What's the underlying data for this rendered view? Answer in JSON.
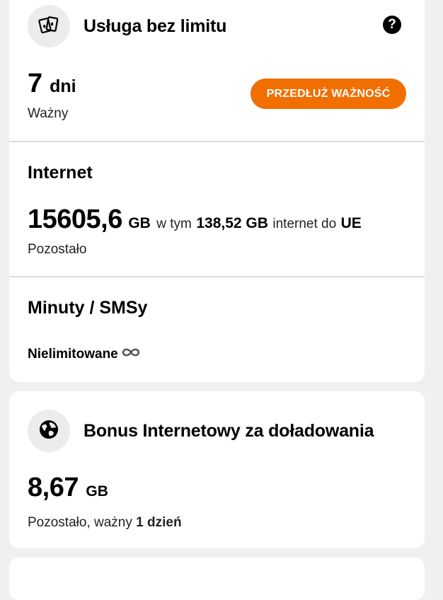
{
  "service": {
    "icon": "cards-icon",
    "title": "Usługa bez limitu",
    "help_label": "?",
    "validity_value": "7",
    "validity_unit": "dni",
    "validity_label": "Ważny",
    "extend_button": "PRZEDŁUŻ WAŻNOŚĆ"
  },
  "internet": {
    "title": "Internet",
    "amount": "15605,6",
    "unit": "GB",
    "in_text": "w tym",
    "eu_amount": "138,52 GB",
    "eu_text": "internet do",
    "eu_label": "UE",
    "remaining_label": "Pozostało"
  },
  "calls": {
    "title": "Minuty / SMSy",
    "value": "Nielimitowane",
    "icon": "infinity-icon"
  },
  "bonus": {
    "icon": "globe-icon",
    "title": "Bonus Internetowy za doładowania",
    "amount": "8,67",
    "unit": "GB",
    "remaining_text": "Pozostało, ważny",
    "validity": "1 dzień"
  },
  "colors": {
    "accent": "#f16e00",
    "card_bg": "#ffffff",
    "page_bg": "#f0f0f0"
  }
}
